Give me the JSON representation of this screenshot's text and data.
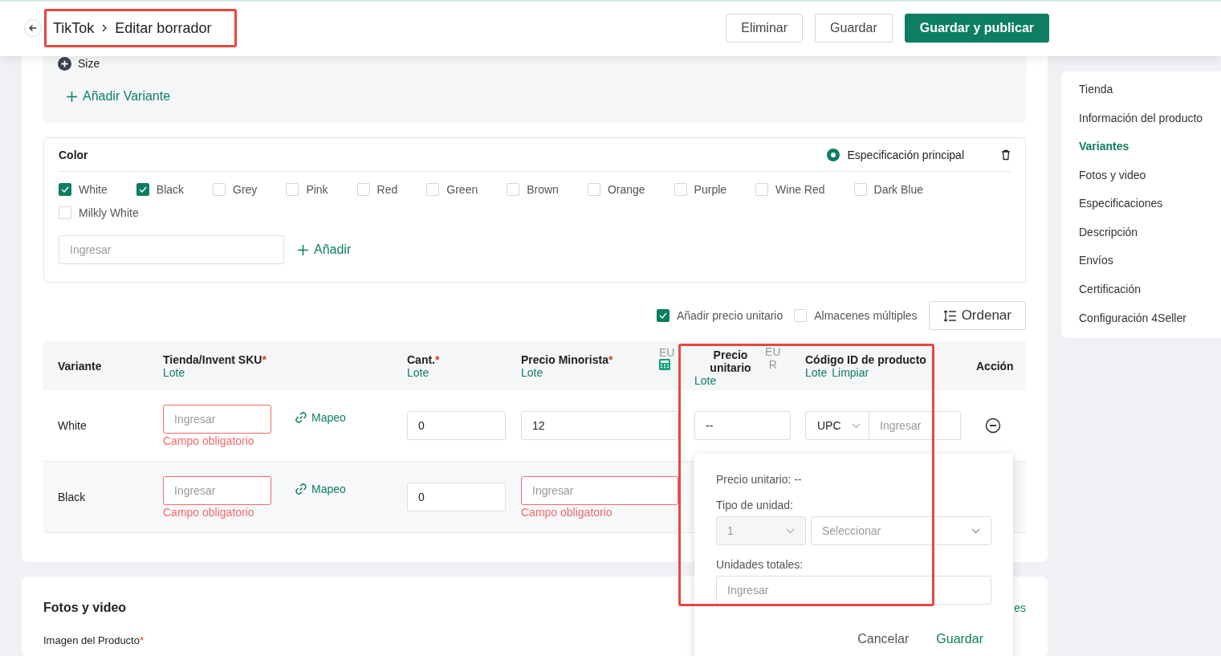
{
  "header": {
    "breadcrumb": [
      "TikTok",
      "Editar borrador"
    ],
    "buttons": [
      {
        "label": "Eliminar",
        "kind": "outline"
      },
      {
        "label": "Guardar",
        "kind": "outline"
      },
      {
        "label": "Guardar y publicar",
        "kind": "primary"
      }
    ]
  },
  "variant_panel": {
    "size_label": "Size",
    "add_variant": "Añadir Variante"
  },
  "color_section": {
    "title": "Color",
    "main_spec": {
      "label": "Especificación principal",
      "selected": true
    },
    "options": [
      {
        "label": "White",
        "checked": true
      },
      {
        "label": "Black",
        "checked": true
      },
      {
        "label": "Grey",
        "checked": false
      },
      {
        "label": "Pink",
        "checked": false
      },
      {
        "label": "Red",
        "checked": false
      },
      {
        "label": "Green",
        "checked": false
      },
      {
        "label": "Brown",
        "checked": false
      },
      {
        "label": "Orange",
        "checked": false
      },
      {
        "label": "Purple",
        "checked": false
      },
      {
        "label": "Wine Red",
        "checked": false
      },
      {
        "label": "Dark Blue",
        "checked": false
      },
      {
        "label": "Milkly White",
        "checked": false
      }
    ],
    "new_option": {
      "placeholder": "Ingresar"
    },
    "add_button": "Añadir"
  },
  "table_options": [
    {
      "label": "Añadir precio unitario",
      "checked": true
    },
    {
      "label": "Almacenes múltiples",
      "checked": false
    }
  ],
  "sort_button": "Ordenar",
  "table": {
    "columns": [
      {
        "title": "Variante"
      },
      {
        "title": "Tienda/Invent SKU",
        "required_mark": "*",
        "links": [
          "Lote"
        ]
      },
      {
        "title": "Cant.",
        "required_mark": "*",
        "links": [
          "Lote"
        ]
      },
      {
        "title": "Precio Minorista",
        "required_mark": "*",
        "links": [
          "Lote"
        ],
        "unit": "EU"
      },
      {
        "title": "Precio unitario",
        "links": [
          "Lote"
        ],
        "unit": "EUR"
      },
      {
        "title": "Código ID de producto",
        "links": [
          "Lote",
          "Limpiar"
        ]
      },
      {
        "title": "Acción"
      }
    ],
    "rows": [
      {
        "variant": "White",
        "sku": {
          "placeholder": "Ingresar",
          "error": "Campo obligatorio"
        },
        "mapping": "Mapeo",
        "quantity": "0",
        "retail_price": {
          "value": "12"
        },
        "unit_price": "--",
        "code_type": "UPC",
        "code": {
          "placeholder": "Ingresar"
        }
      },
      {
        "variant": "Black",
        "sku": {
          "placeholder": "Ingresar",
          "error": "Campo obligatorio"
        },
        "mapping": "Mapeo",
        "quantity": "0",
        "retail_price": {
          "placeholder": "Ingresar",
          "error": "Campo obligatorio"
        }
      }
    ]
  },
  "popup": {
    "summary": "Precio unitario: --",
    "unit_type_label": "Tipo de unidad:",
    "unit_count": {
      "value": "1",
      "disabled": true
    },
    "unit_select": {
      "placeholder": "Seleccionar"
    },
    "total_label": "Unidades totales:",
    "total_input": {
      "placeholder": "Ingresar"
    },
    "buttons": [
      {
        "label": "Cancelar",
        "kind": "text"
      },
      {
        "label": "Guardar",
        "kind": "link"
      }
    ]
  },
  "photos_section": {
    "title": "Fotos y video",
    "field_label": "Imagen del Producto",
    "required_mark": "*",
    "link_fragment": "es"
  },
  "sidebar": {
    "items": [
      {
        "label": "Tienda",
        "selected": false
      },
      {
        "label": "Información del producto",
        "selected": false
      },
      {
        "label": "Variantes",
        "selected": true
      },
      {
        "label": "Fotos y video",
        "selected": false
      },
      {
        "label": "Especificaciones",
        "selected": false
      },
      {
        "label": "Descripción",
        "selected": false
      },
      {
        "label": "Envíos",
        "selected": false
      },
      {
        "label": "Certificación",
        "selected": false
      },
      {
        "label": "Configuración 4Seller",
        "selected": false
      }
    ]
  }
}
